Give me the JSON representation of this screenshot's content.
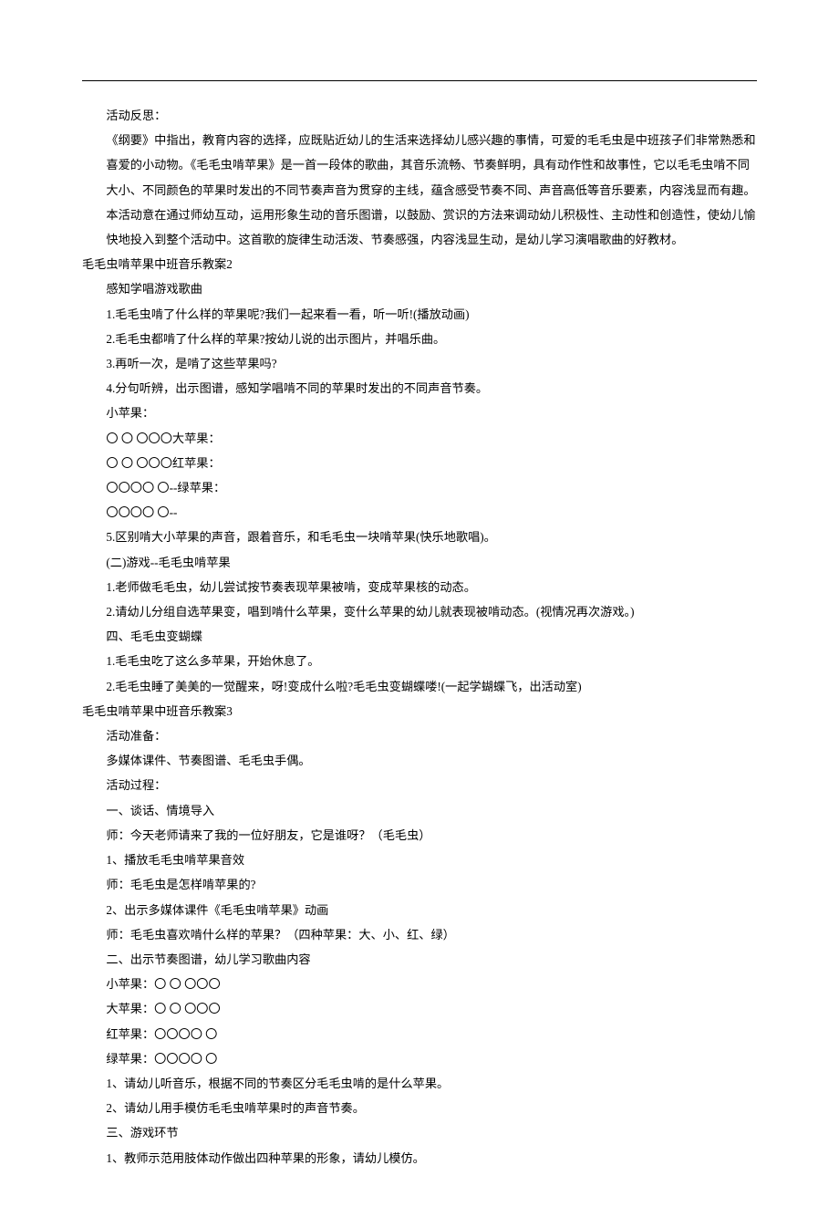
{
  "lines": [
    {
      "indent": 1,
      "text": "活动反思："
    },
    {
      "indent": 1,
      "text": "《纲要》中指出，教育内容的选择，应既贴近幼儿的生活来选择幼儿感兴趣的事情，可爱的毛毛虫是中班孩子们非常熟悉和喜爱的小动物。《毛毛虫啃苹果》是一首一段体的歌曲，其音乐流畅、节奏鲜明，具有动作性和故事性，它以毛毛虫啃不同大小、不同颜色的苹果时发出的不同节奏声音为贯穿的主线，蕴含感受节奏不同、声音高低等音乐要素，内容浅显而有趣。本活动意在通过师幼互动，运用形象生动的音乐图谱，以鼓励、赏识的方法来调动幼儿积极性、主动性和创造性，使幼儿愉快地投入到整个活动中。这首歌的旋律生动活泼、节奏感强，内容浅显生动，是幼儿学习演唱歌曲的好教材。"
    },
    {
      "indent": 0,
      "text": "毛毛虫啃苹果中班音乐教案2"
    },
    {
      "indent": 1,
      "text": "感知学唱游戏歌曲"
    },
    {
      "indent": 1,
      "text": "1.毛毛虫啃了什么样的苹果呢?我们一起来看一看，听一听!(播放动画)"
    },
    {
      "indent": 1,
      "text": "2.毛毛虫都啃了什么样的苹果?按幼儿说的出示图片，并唱乐曲。"
    },
    {
      "indent": 1,
      "text": "3.再听一次，是啃了这些苹果吗?"
    },
    {
      "indent": 1,
      "text": "4.分句听辨，出示图谱，感知学唱啃不同的苹果时发出的不同声音节奏。"
    },
    {
      "indent": 1,
      "text": "小苹果："
    },
    {
      "indent": 1,
      "text": "〇 〇 〇〇〇大苹果："
    },
    {
      "indent": 1,
      "text": "〇 〇 〇〇〇红苹果："
    },
    {
      "indent": 1,
      "text": "〇〇〇〇 〇--绿苹果："
    },
    {
      "indent": 1,
      "text": "〇〇〇〇 〇--"
    },
    {
      "indent": 1,
      "text": "5.区别啃大小苹果的声音，跟着音乐，和毛毛虫一块啃苹果(快乐地歌唱)。"
    },
    {
      "indent": 1,
      "text": "(二)游戏--毛毛虫啃苹果"
    },
    {
      "indent": 1,
      "text": "1.老师做毛毛虫，幼儿尝试按节奏表现苹果被啃，变成苹果核的动态。"
    },
    {
      "indent": 1,
      "text": "2.请幼儿分组自选苹果变，唱到啃什么苹果，变什么苹果的幼儿就表现被啃动态。(视情况再次游戏。)"
    },
    {
      "indent": 1,
      "text": "四、毛毛虫变蝴蝶"
    },
    {
      "indent": 1,
      "text": "1.毛毛虫吃了这么多苹果，开始休息了。"
    },
    {
      "indent": 1,
      "text": "2.毛毛虫睡了美美的一觉醒来，呀!变成什么啦?毛毛虫变蝴蝶喽!(一起学蝴蝶飞，出活动室)"
    },
    {
      "indent": 0,
      "text": "毛毛虫啃苹果中班音乐教案3"
    },
    {
      "indent": 1,
      "text": "活动准备："
    },
    {
      "indent": 1,
      "text": "多媒体课件、节奏图谱、毛毛虫手偶。"
    },
    {
      "indent": 1,
      "text": "活动过程："
    },
    {
      "indent": 1,
      "text": "一、谈话、情境导入"
    },
    {
      "indent": 1,
      "text": "师：今天老师请来了我的一位好朋友，它是谁呀？（毛毛虫）"
    },
    {
      "indent": 1,
      "text": "1、播放毛毛虫啃苹果音效"
    },
    {
      "indent": 1,
      "text": "师：毛毛虫是怎样啃苹果的?"
    },
    {
      "indent": 1,
      "text": "2、出示多媒体课件《毛毛虫啃苹果》动画"
    },
    {
      "indent": 1,
      "text": "师：毛毛虫喜欢啃什么样的苹果？（四种苹果：大、小、红、绿）"
    },
    {
      "indent": 1,
      "text": "二、出示节奏图谱，幼儿学习歌曲内容"
    },
    {
      "indent": 1,
      "text": "小苹果：〇 〇 〇〇〇"
    },
    {
      "indent": 1,
      "text": "大苹果：〇 〇 〇〇〇"
    },
    {
      "indent": 1,
      "text": "红苹果：〇〇〇〇 〇"
    },
    {
      "indent": 1,
      "text": "绿苹果：〇〇〇〇 〇"
    },
    {
      "indent": 1,
      "text": "1、请幼儿听音乐，根据不同的节奏区分毛毛虫啃的是什么苹果。"
    },
    {
      "indent": 1,
      "text": "2、请幼儿用手模仿毛毛虫啃苹果时的声音节奏。"
    },
    {
      "indent": 1,
      "text": "三、游戏环节"
    },
    {
      "indent": 1,
      "text": "1、教师示范用肢体动作做出四种苹果的形象，请幼儿模仿。"
    }
  ]
}
